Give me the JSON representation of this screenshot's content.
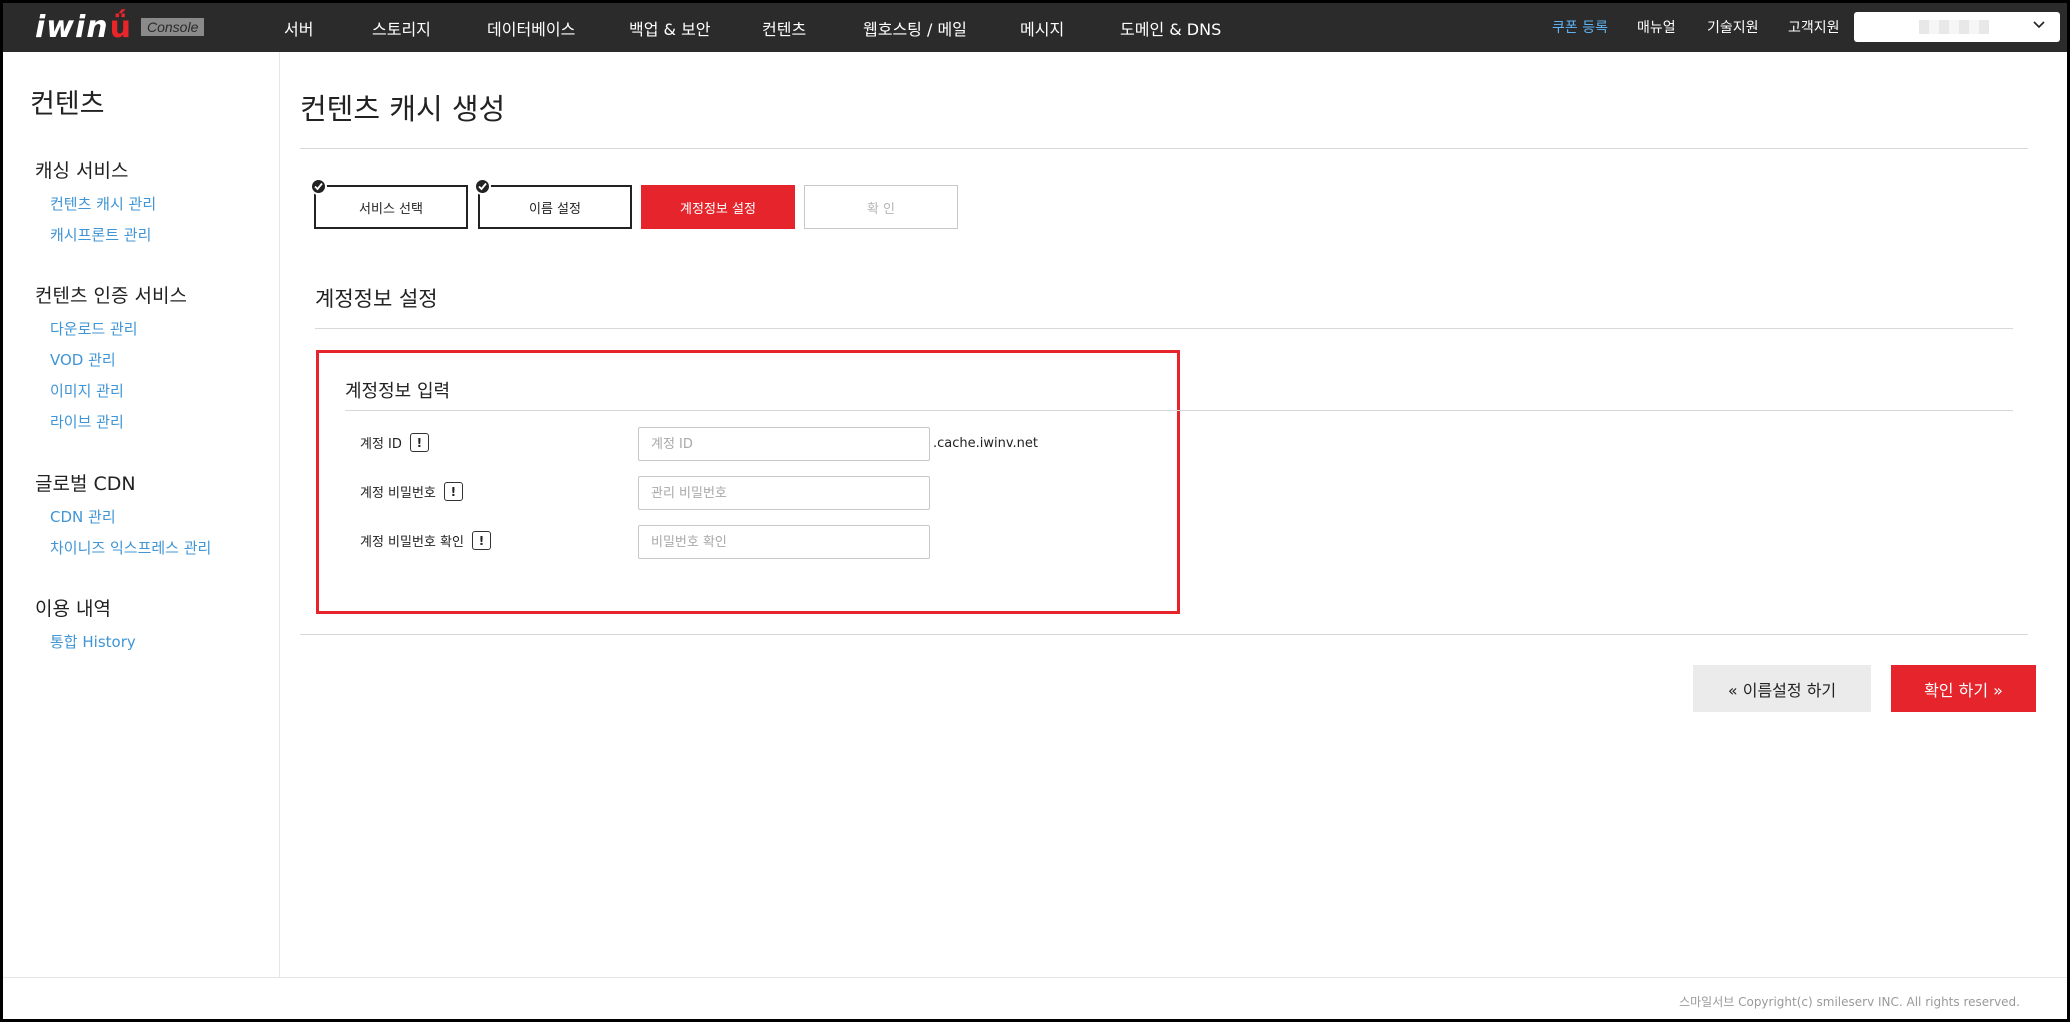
{
  "brand": {
    "logo_text": "iwin",
    "logo_smile": "ǘ",
    "badge": "Console"
  },
  "main_nav": [
    {
      "label": "서버"
    },
    {
      "label": "스토리지"
    },
    {
      "label": "데이터베이스"
    },
    {
      "label": "백업 & 보안"
    },
    {
      "label": "컨텐츠"
    },
    {
      "label": "웹호스팅 / 메일"
    },
    {
      "label": "메시지"
    },
    {
      "label": "도메인 & DNS"
    }
  ],
  "right_nav": {
    "coupon": "쿠폰 등록",
    "manual": "매뉴얼",
    "tech_support": "기술지원",
    "customer_support": "고객지원"
  },
  "colors": {
    "accent": "#e5252b",
    "link": "#3f95d5",
    "topbar": "#2b2b2b",
    "coupon": "#5fb4f5"
  },
  "sidebar": {
    "title": "컨텐츠",
    "groups": [
      {
        "label": "캐싱 서비스",
        "items": [
          "컨텐츠 캐시 관리",
          "캐시프론트 관리"
        ]
      },
      {
        "label": "컨텐츠 인증 서비스",
        "items": [
          "다운로드 관리",
          "VOD 관리",
          "이미지 관리",
          "라이브 관리"
        ]
      },
      {
        "label": "글로벌 CDN",
        "items": [
          "CDN 관리",
          "차이니즈 익스프레스 관리"
        ]
      },
      {
        "label": "이용 내역",
        "items": [
          "통합 History"
        ]
      }
    ]
  },
  "page": {
    "title": "컨텐츠 캐시 생성",
    "steps": [
      {
        "label": "서비스 선택",
        "state": "done"
      },
      {
        "label": "이름 설정",
        "state": "done"
      },
      {
        "label": "계정정보 설정",
        "state": "active"
      },
      {
        "label": "확 인",
        "state": "disabled"
      }
    ],
    "section_title": "계정정보 설정",
    "form": {
      "title": "계정정보 입력",
      "fields": [
        {
          "label": "계정 ID",
          "placeholder": "계정 ID",
          "value": "",
          "suffix": ".cache.iwinv.net"
        },
        {
          "label": "계정 비밀번호",
          "placeholder": "관리 비밀번호",
          "value": ""
        },
        {
          "label": "계정 비밀번호 확인",
          "placeholder": "비밀번호 확인",
          "value": ""
        }
      ],
      "info_glyph": "!"
    },
    "buttons": {
      "prev": "« 이름설정 하기",
      "next": "확인 하기 »"
    }
  },
  "footer": {
    "copyright": "스마일서브 Copyright(c) smileserv INC. All rights reserved."
  }
}
